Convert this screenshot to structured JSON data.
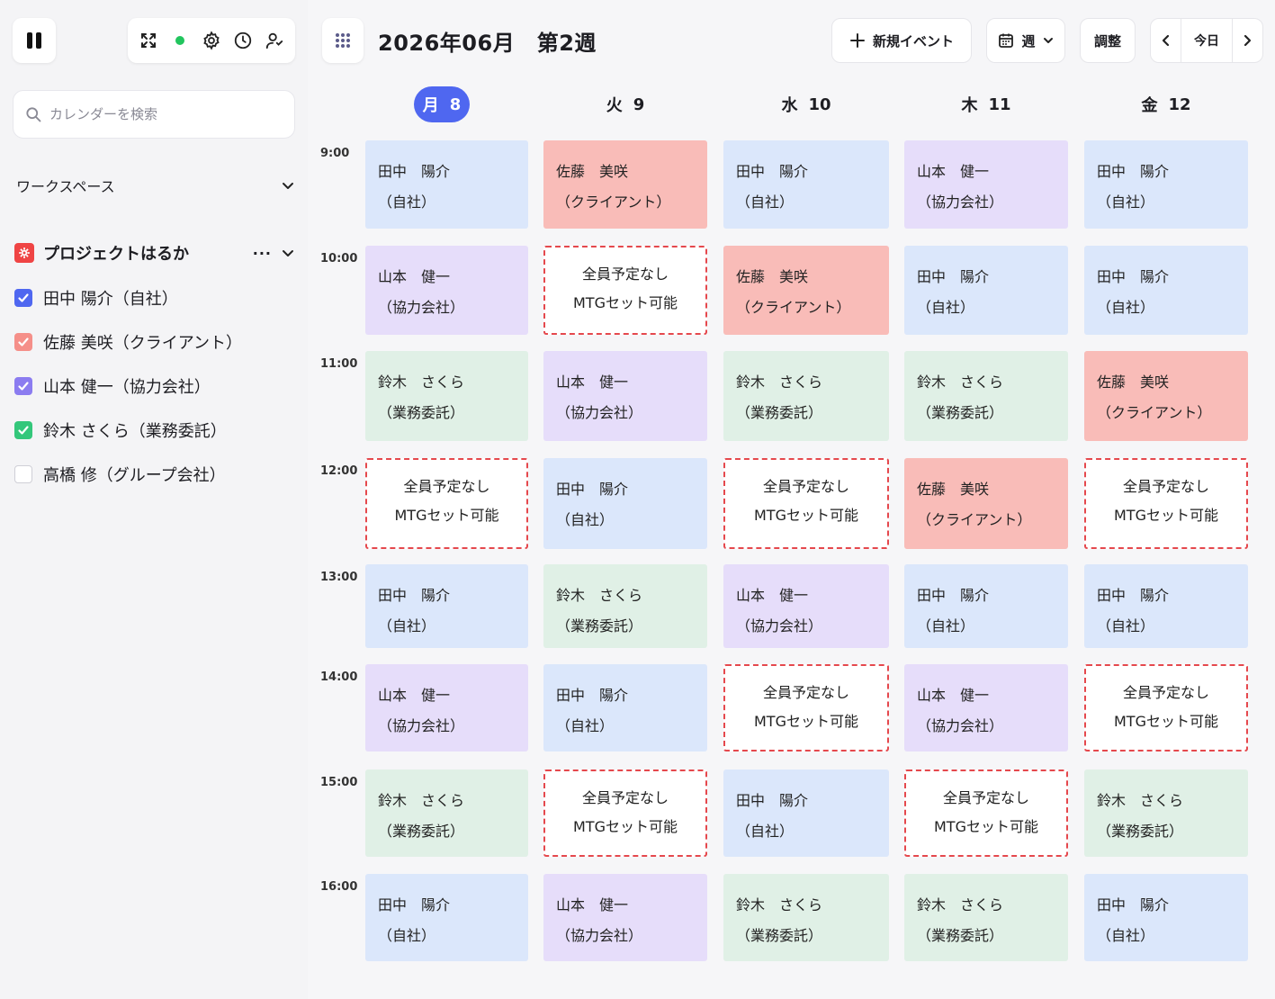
{
  "toolbar": {
    "icons": [
      "pause-icon",
      "expand-icon",
      "status-dot",
      "gear-icon",
      "clock-icon",
      "user-icon"
    ],
    "status_color": "#22c55e"
  },
  "search": {
    "placeholder": "カレンダーを検索"
  },
  "workspace": {
    "label": "ワークスペース"
  },
  "project": {
    "name": "プロジェクトはるか",
    "more": "···"
  },
  "members": [
    {
      "name": "田中 陽介（自社）",
      "checked": true,
      "color": "#4f67f0"
    },
    {
      "name": "佐藤 美咲（クライアント）",
      "checked": true,
      "color": "#f58f89"
    },
    {
      "name": "山本 健一（協力会社）",
      "checked": true,
      "color": "#8b7cf0"
    },
    {
      "name": "鈴木 さくら（業務委託）",
      "checked": true,
      "color": "#34c77b"
    },
    {
      "name": "高橋 修（グループ会社）",
      "checked": false,
      "color": "#cfcfd6"
    }
  ],
  "header": {
    "title": "2026年06月　第2週",
    "new_event": "新規イベント",
    "view": "週",
    "adjust": "調整",
    "today": "今日",
    "accent": "#4f67f0"
  },
  "days": [
    {
      "dow": "月",
      "date": "8",
      "today": true
    },
    {
      "dow": "火",
      "date": "9",
      "today": false
    },
    {
      "dow": "水",
      "date": "10",
      "today": false
    },
    {
      "dow": "木",
      "date": "11",
      "today": false
    },
    {
      "dow": "金",
      "date": "12",
      "today": false
    }
  ],
  "times": [
    "9:00",
    "10:00",
    "11:00",
    "12:00",
    "13:00",
    "14:00",
    "15:00",
    "16:00"
  ],
  "event_types": {
    "own": {
      "line1": "田中　陽介",
      "line2": "（自社）",
      "color": "#dbe7fb"
    },
    "client": {
      "line1": "佐藤　美咲",
      "line2": "（クライアント）",
      "color": "#f9bcb8"
    },
    "partner": {
      "line1": "山本　健一",
      "line2": "（協力会社）",
      "color": "#e6ddfa"
    },
    "contract": {
      "line1": "鈴木　さくら",
      "line2": "（業務委託）",
      "color": "#e0f0e6"
    },
    "free": {
      "line1": "全員予定なし",
      "line2": "MTGセット可能",
      "color": "#e5484d"
    }
  },
  "grid": [
    [
      "own",
      "client",
      "own",
      "partner",
      "own"
    ],
    [
      "partner",
      "free",
      "client",
      "own",
      "own"
    ],
    [
      "contract",
      "partner",
      "contract",
      "contract",
      "client"
    ],
    [
      "free",
      "own",
      "free",
      "client",
      "free"
    ],
    [
      "own",
      "contract",
      "partner",
      "own",
      "own"
    ],
    [
      "partner",
      "own",
      "free",
      "partner",
      "free"
    ],
    [
      "contract",
      "free",
      "own",
      "free",
      "contract"
    ],
    [
      "own",
      "partner",
      "contract",
      "contract",
      "own"
    ]
  ]
}
